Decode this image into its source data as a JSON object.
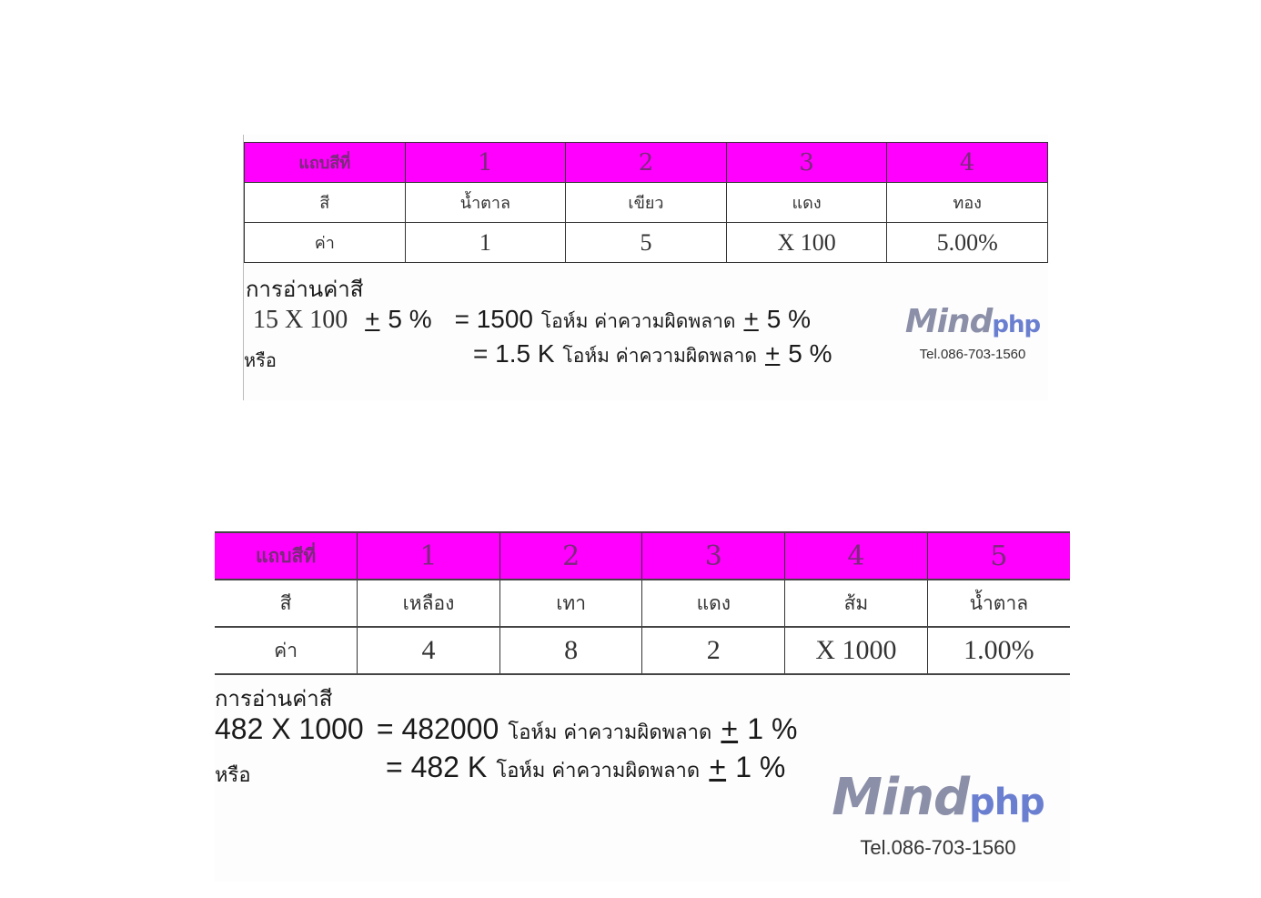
{
  "example1": {
    "header": [
      "แถบสีที่",
      "1",
      "2",
      "3",
      "4"
    ],
    "colors": [
      "สี",
      "น้ำตาล",
      "เขียว",
      "แดง",
      "ทอง"
    ],
    "values": [
      "ค่า",
      "1",
      "5",
      "X 100",
      "5.00%"
    ],
    "reading_title": "การอ่านค่าสี",
    "line1": {
      "expr": "15 X 100",
      "pm": "+",
      "tol": "5 %",
      "eq": "= 1500",
      "unit": "โอห์ม ค่าความผิดพลาด",
      "pm2": "+",
      "tol2": "5 %"
    },
    "line2": {
      "or": "หรือ",
      "eq": "=  1.5 K",
      "unit": "โอห์ม ค่าความผิดพลาด",
      "pm2": "+",
      "tol2": "5 %"
    },
    "logo": {
      "brand": "Mind",
      "brand_php": "php",
      "tel": "Tel.086-703-1560"
    }
  },
  "example2": {
    "header": [
      "แถบสีที่",
      "1",
      "2",
      "3",
      "4",
      "5"
    ],
    "colors": [
      "สี",
      "เหลือง",
      "เทา",
      "แดง",
      "ส้ม",
      "น้ำตาล"
    ],
    "values": [
      "ค่า",
      "4",
      "8",
      "2",
      "X 1000",
      "1.00%"
    ],
    "reading_title": "การอ่านค่าสี",
    "line1": {
      "expr": "482 X 1000",
      "eq": "= 482000",
      "unit": "โอห์ม ค่าความผิดพลาด",
      "pm2": "+",
      "tol2": "1 %"
    },
    "line2": {
      "or": "หรือ",
      "eq": "= 482 K",
      "unit": "โอห์ม ค่าความผิดพลาด",
      "pm2": "+",
      "tol2": "1 %"
    },
    "logo": {
      "brand": "Mind",
      "brand_php": "php",
      "tel": "Tel.086-703-1560"
    }
  },
  "colors": {
    "header_bg": "#ff00ff",
    "header_text": "#7a2a7a"
  }
}
